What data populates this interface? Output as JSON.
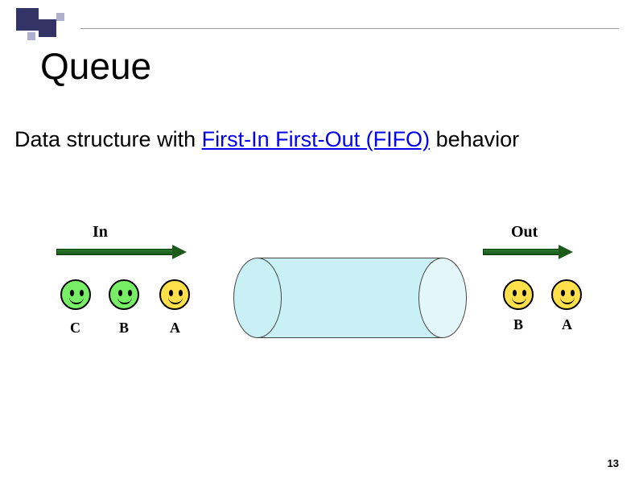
{
  "title": "Queue",
  "subtitle_pre": "Data structure with ",
  "subtitle_link": "First-In First-Out (FIFO)",
  "subtitle_post": " behavior",
  "labels": {
    "in": "In",
    "out": "Out"
  },
  "faces_in": [
    "C",
    "B",
    "A"
  ],
  "faces_out": [
    "B",
    "A"
  ],
  "page_number": "13"
}
